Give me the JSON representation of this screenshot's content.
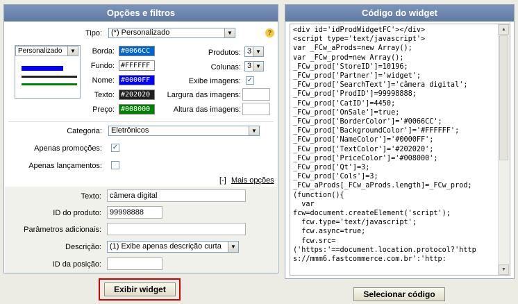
{
  "left_panel": {
    "title": "Opções e filtros",
    "tipo": {
      "label": "Tipo:",
      "value": "(*) Personalizado",
      "help": "?"
    },
    "preview": {
      "select_value": "Personalizado"
    },
    "colors": [
      {
        "label": "Borda:",
        "value": "#0066CC",
        "bg": "#0066CC",
        "fg": "#ffffff"
      },
      {
        "label": "Fundo:",
        "value": "#FFFFFF",
        "bg": "#FFFFFF",
        "fg": "#000000"
      },
      {
        "label": "Nome:",
        "value": "#0000FF",
        "bg": "#0000FF",
        "fg": "#ffffff"
      },
      {
        "label": "Texto:",
        "value": "#202020",
        "bg": "#202020",
        "fg": "#ffffff"
      },
      {
        "label": "Preço:",
        "value": "#008000",
        "bg": "#008000",
        "fg": "#ffffff"
      }
    ],
    "produtos": {
      "label": "Produtos:",
      "value": "3"
    },
    "colunas": {
      "label": "Colunas:",
      "value": "3"
    },
    "exibe_imagens": {
      "label": "Exibe imagens:",
      "checked": true
    },
    "largura": {
      "label": "Largura das imagens:",
      "value": ""
    },
    "altura": {
      "label": "Altura das imagens:",
      "value": ""
    },
    "categoria": {
      "label": "Categoria:",
      "value": "Eletrônicos"
    },
    "apenas_promocoes": {
      "label": "Apenas promoções:",
      "checked": true
    },
    "apenas_lancamentos": {
      "label": "Apenas lançamentos:",
      "checked": false
    },
    "mais_opcoes": {
      "prefix": "[-]",
      "link": "Mais opções"
    },
    "texto": {
      "label": "Texto:",
      "value": "câmera digital"
    },
    "id_produto": {
      "label": "ID do produto:",
      "value": "99998888"
    },
    "parametros": {
      "label": "Parâmetros adicionais:",
      "value": ""
    },
    "descricao": {
      "label": "Descrição:",
      "value": "(1) Exibe apenas descrição curta"
    },
    "id_posicao": {
      "label": "ID da posição:",
      "value": ""
    }
  },
  "right_panel": {
    "title": "Código do widget",
    "code": "<div id='idProdWidgetFC'></div>\n<script type='text/javascript'>\nvar _FCw_aProds=new Array();\nvar _FCw_prod=new Array();\n_FCw_prod['StoreID']=10196;\n_FCw_prod['Partner']='widget';\n_FCw_prod['SearchText']='câmera digital';\n_FCw_prod['ProdID']=99998888;\n_FCw_prod['CatID']=4450;\n_FCw_prod['OnSale']=true;\n_FCw_prod['BorderColor']='#0066CC';\n_FCw_prod['BackgroundColor']='#FFFFFF';\n_FCw_prod['NameColor']='#0000FF';\n_FCw_prod['TextColor']='#202020';\n_FCw_prod['PriceColor']='#008000';\n_FCw_prod['Qt']=3;\n_FCw_prod['Cols']=3;\n_FCw_aProds[_FCw_aProds.length]=_FCw_prod;\n(function(){\n  var\nfcw=document.createElement('script');\n  fcw.type='text/javascript';\n  fcw.async=true;\n  fcw.src=\n('https:'==document.location.protocol?'https://mmm6.fastcommerce.com.br':'http:"
  },
  "buttons": {
    "show_widget": "Exibir widget",
    "select_code": "Selecionar código"
  },
  "colors": {
    "header": "#6680a8",
    "highlight_border": "#d00000"
  }
}
